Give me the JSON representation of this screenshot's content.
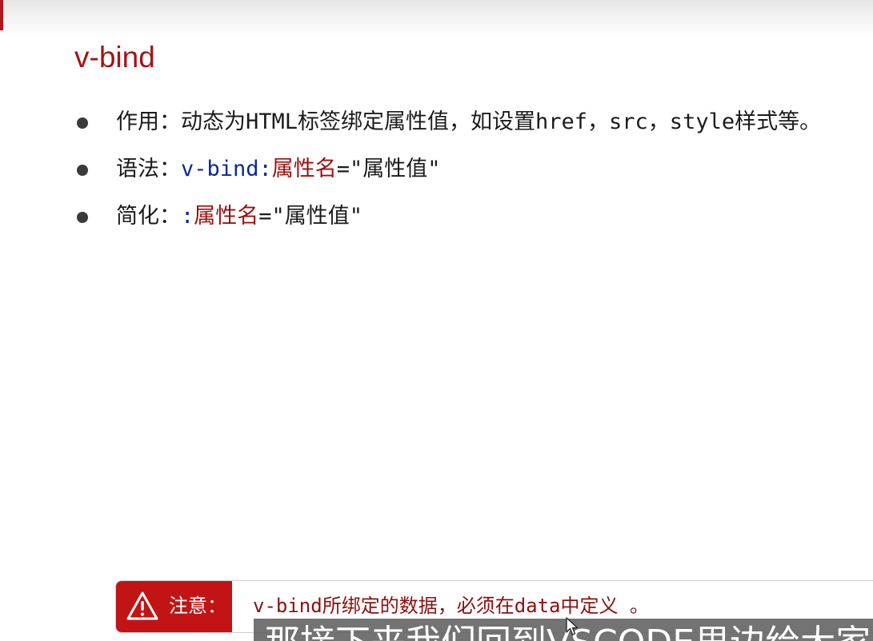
{
  "slide": {
    "title": "v-bind",
    "bullets": [
      {
        "label": "作用：",
        "text": "动态为HTML标签绑定属性值，如设置href，src，style样式等。"
      },
      {
        "label": "语法：",
        "directive": "v-bind:",
        "attr_name": "属性名",
        "equals_value": "=\"属性值\""
      },
      {
        "label": "简化：",
        "directive": ":",
        "attr_name": "属性名",
        "equals_value": "=\"属性值\""
      }
    ],
    "note": {
      "icon": "warning-icon",
      "label": "注意：",
      "text": "v-bind所绑定的数据，必须在data中定义 。"
    }
  },
  "subtitle": {
    "text": "那接下来我们回到VSCODE里边给大家"
  },
  "colors": {
    "accent": "#b0181d",
    "title": "#a11418",
    "directive": "#0b2a9a",
    "attr_name": "#9a1010",
    "note_label_bg": "#c21414"
  }
}
